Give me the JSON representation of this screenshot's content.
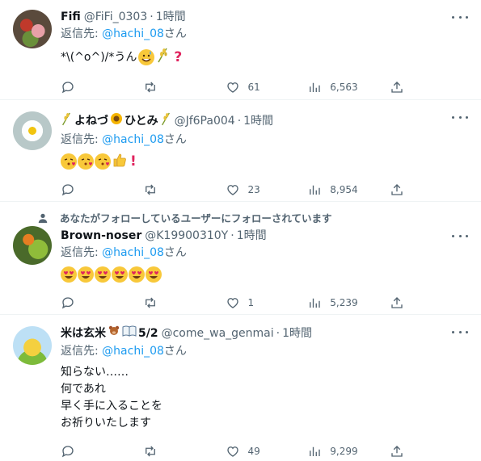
{
  "tweets": [
    {
      "name": "Fifi",
      "handle": "@FiFi_0303",
      "time": "1時間",
      "reply_prefix": "返信先:",
      "reply_to": "@hachi_08",
      "reply_suffix": "さん",
      "text": "*\\(^o^)/*うん",
      "likes": "61",
      "views": "6,563"
    },
    {
      "name": "よねづ",
      "name2": "ひとみ",
      "handle": "@Jf6Pa004",
      "time": "1時間",
      "reply_prefix": "返信先:",
      "reply_to": "@hachi_08",
      "reply_suffix": "さん",
      "likes": "23",
      "views": "8,954"
    },
    {
      "social_context": "あなたがフォローしているユーザーにフォローされています",
      "name": "Brown-noser",
      "handle": "@K19900310Y",
      "time": "1時間",
      "reply_prefix": "返信先:",
      "reply_to": "@hachi_08",
      "reply_suffix": "さん",
      "likes": "1",
      "views": "5,239"
    },
    {
      "name": "米は玄米",
      "name_suffix": "5/2",
      "handle": "@come_wa_genmai",
      "time": "1時間",
      "reply_prefix": "返信先:",
      "reply_to": "@hachi_08",
      "reply_suffix": "さん",
      "text": "知らない……\n何であれ\n早く手に入ることを\nお祈りいたします",
      "likes": "49",
      "views": "9,299"
    }
  ],
  "separator": "·",
  "icons": [
    "more-icon",
    "reply-icon",
    "retweet-icon",
    "like-icon",
    "views-icon",
    "share-icon",
    "person-icon"
  ]
}
